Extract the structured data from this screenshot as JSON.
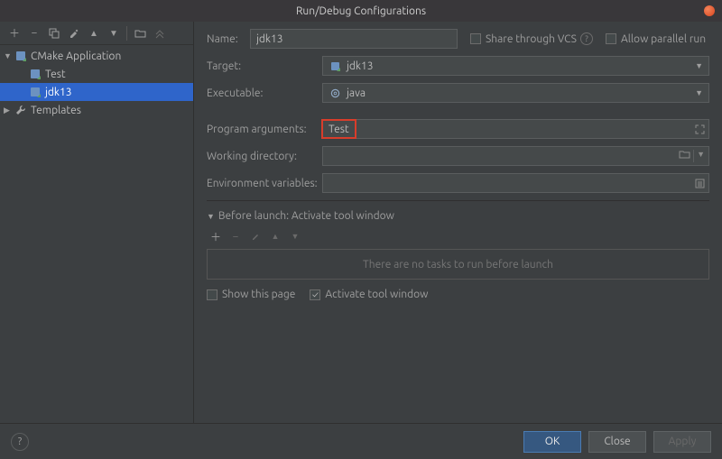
{
  "window": {
    "title": "Run/Debug Configurations"
  },
  "sidebar": {
    "group": "CMake Application",
    "items": [
      {
        "label": "Test"
      },
      {
        "label": "jdk13"
      }
    ],
    "templates": "Templates"
  },
  "form": {
    "name_label": "Name:",
    "name_value": "jdk13",
    "share_label": "Share through VCS",
    "parallel_label": "Allow parallel run",
    "target_label": "Target:",
    "target_value": "jdk13",
    "exec_label": "Executable:",
    "exec_value": "java",
    "args_label": "Program arguments:",
    "args_value": "Test",
    "wd_label": "Working directory:",
    "env_label": "Environment variables:"
  },
  "before": {
    "header": "Before launch: Activate tool window",
    "empty": "There are no tasks to run before launch",
    "show_page": "Show this page",
    "activate": "Activate tool window"
  },
  "buttons": {
    "ok": "OK",
    "close": "Close",
    "apply": "Apply"
  }
}
